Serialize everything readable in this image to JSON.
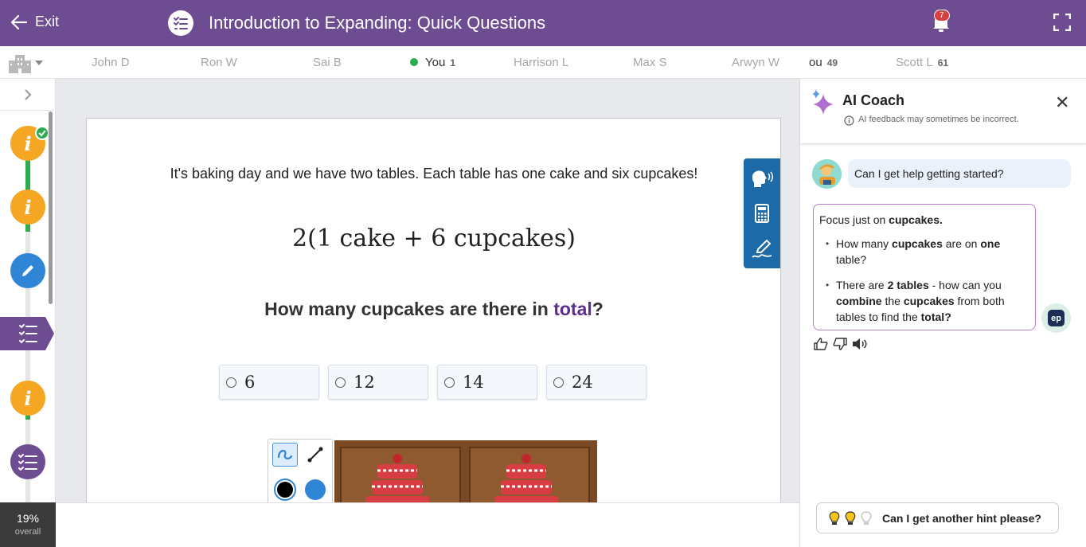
{
  "header": {
    "exit_label": "Exit",
    "title": "Introduction to Expanding: Quick Questions",
    "notification_count": "7"
  },
  "leaderboard": {
    "players": [
      {
        "name": "John D",
        "score": ""
      },
      {
        "name": "Ron W",
        "score": ""
      },
      {
        "name": "Sai B",
        "score": ""
      },
      {
        "name": "You",
        "score": "1"
      },
      {
        "name": "Harrison L",
        "score": ""
      },
      {
        "name": "Max S",
        "score": ""
      },
      {
        "name": "Arwyn W",
        "score": ""
      },
      {
        "name": "ou",
        "score": "49"
      },
      {
        "name": "Scott L",
        "score": "61"
      }
    ]
  },
  "sidebar": {
    "overall_percent": "19%",
    "overall_label": "overall",
    "steps": [
      {
        "type": "info",
        "icon": "info-icon",
        "status": "complete",
        "symbol": "i"
      },
      {
        "type": "info",
        "icon": "info-icon",
        "status": "complete",
        "symbol": "i"
      },
      {
        "type": "task",
        "icon": "pencil-icon",
        "status": "in-progress",
        "symbol": "✎"
      },
      {
        "type": "quiz",
        "icon": "checklist-icon",
        "status": "current",
        "symbol": "☰"
      },
      {
        "type": "info",
        "icon": "info-icon",
        "status": "upcoming",
        "symbol": "i"
      },
      {
        "type": "quiz",
        "icon": "checklist-icon",
        "status": "upcoming",
        "symbol": "☰"
      }
    ]
  },
  "question": {
    "intro": "It's baking day and we have two tables. Each table has one cake and six cupcakes!",
    "formula": "2(1 cake + 6 cupcakes)",
    "prompt_before": "How many cupcakes are there in ",
    "prompt_highlight": "total",
    "prompt_after": "?",
    "choices": [
      "6",
      "12",
      "14",
      "24"
    ]
  },
  "coach": {
    "title": "AI Coach",
    "disclaimer": "AI feedback may sometimes be incorrect.",
    "user_message": "Can I get help getting started?",
    "ai_intro_prefix": "Focus just on ",
    "ai_intro_bold": "cupcakes.",
    "ai_bullet1": {
      "a": "How many ",
      "b": "cupcakes",
      "c": " are on ",
      "d": "one",
      "e": " table?"
    },
    "ai_bullet2": {
      "a": "There are ",
      "b": "2 tables",
      "c": " - how can you ",
      "d": "combine",
      "e": " the ",
      "f": "cupcakes",
      "g": " from both tables to find the ",
      "h": "total?"
    },
    "ep_label": "ep",
    "hint_button": "Can I get another hint please?",
    "hints_remaining": 2,
    "hints_total": 3
  },
  "colors": {
    "brand_purple": "#6e4c91",
    "highlight_purple": "#5b2d8f",
    "progress_green": "#2dab4f",
    "info_orange": "#f5a623",
    "tool_blue": "#1c6aa8"
  }
}
